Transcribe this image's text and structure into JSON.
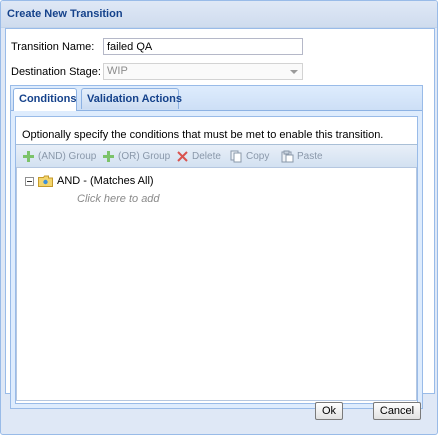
{
  "dialog": {
    "title": "Create New Transition"
  },
  "form": {
    "transition_name_label": "Transition Name:",
    "transition_name_value": "failed QA",
    "destination_stage_label": "Destination Stage:",
    "destination_stage_value": "WIP"
  },
  "tabs": [
    {
      "label": "Conditions",
      "active": true
    },
    {
      "label": "Validation Actions",
      "active": false
    }
  ],
  "conditions": {
    "description": "Optionally specify the conditions that must be met to enable this transition.",
    "toolbar": {
      "and_group": "(AND) Group",
      "or_group": "(OR) Group",
      "delete": "Delete",
      "copy": "Copy",
      "paste": "Paste"
    },
    "tree": {
      "root_label": "AND - (Matches All)",
      "placeholder": "Click here to add"
    }
  },
  "buttons": {
    "ok": "Ok",
    "cancel": "Cancel"
  },
  "colors": {
    "title_text": "#15428b",
    "panel_border": "#99bbe8",
    "toolbar_disabled": "#8a98aa",
    "add_icon": "#5fb04c",
    "delete_icon": "#d04040"
  }
}
